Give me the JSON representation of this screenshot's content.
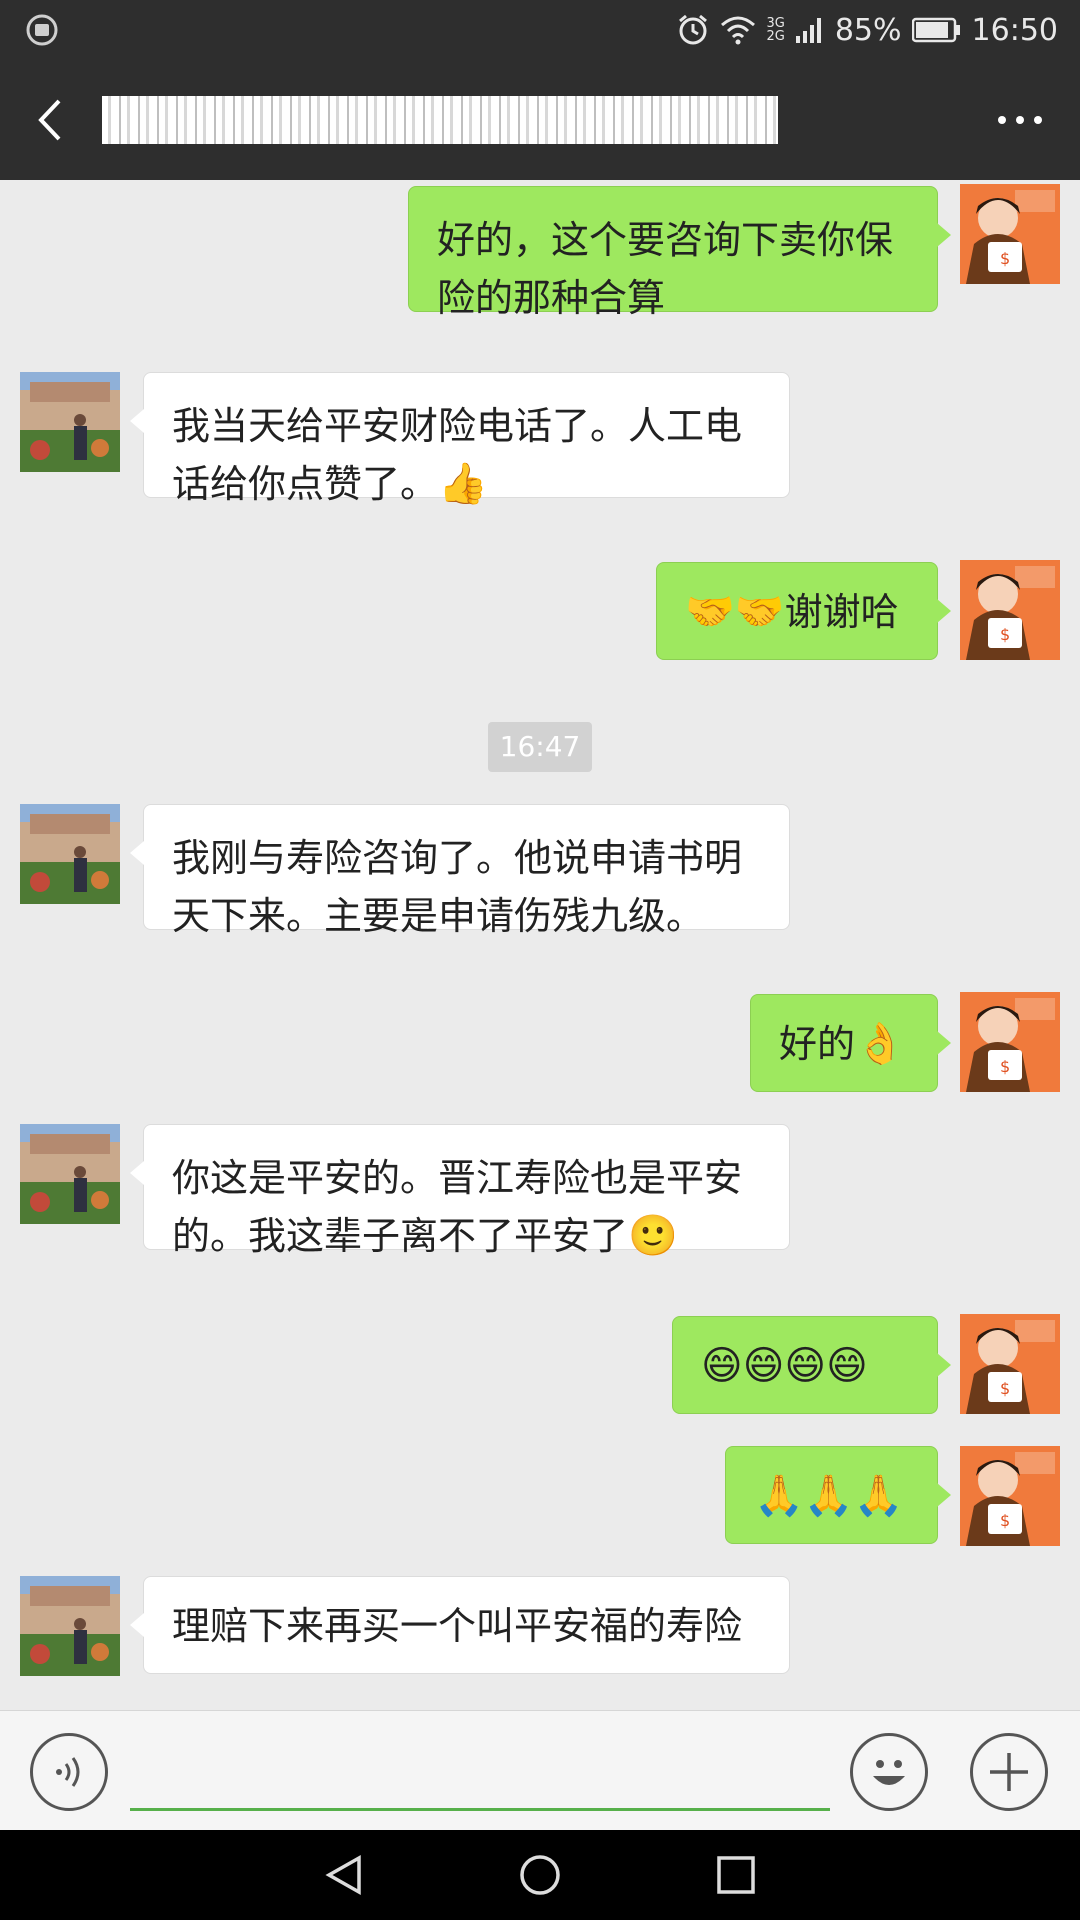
{
  "status_bar": {
    "alarm_icon": "alarm-icon",
    "wifi_icon": "wifi-icon",
    "network_top": "3G",
    "network_bottom": "2G",
    "battery": "85%",
    "time": "16:50"
  },
  "header": {
    "title_redacted": true
  },
  "messages": [
    {
      "side": "out",
      "text": "好的，这个要咨询下卖你保险的那种合算"
    },
    {
      "side": "in",
      "text": "我当天给平安财险电话了。人工电话给你点赞了。",
      "emoji": "👍"
    },
    {
      "side": "out",
      "emoji_prefix": "🤝🤝",
      "text": "谢谢哈"
    },
    {
      "side": "in",
      "text": "我刚与寿险咨询了。他说申请书明天下来。主要是申请伤残九级。"
    },
    {
      "side": "out",
      "text": "好的",
      "emoji": "👌"
    },
    {
      "side": "in",
      "text": "你这是平安的。晋江寿险也是平安的。我这辈子离不了平安了",
      "emoji": "🙂"
    },
    {
      "side": "out",
      "emoji_only": "😄😄😄😄"
    },
    {
      "side": "out",
      "emoji_only": "🙏🙏🙏"
    },
    {
      "side": "in",
      "text": "理赔下来再买一个叫平安福的寿险"
    }
  ],
  "timestamp": "16:47",
  "colors": {
    "bar": "#2e2e2e",
    "chat_bg": "#ebebeb",
    "out_bubble": "#9ee85f",
    "in_bubble": "#ffffff",
    "input_underline": "#56b04a"
  }
}
